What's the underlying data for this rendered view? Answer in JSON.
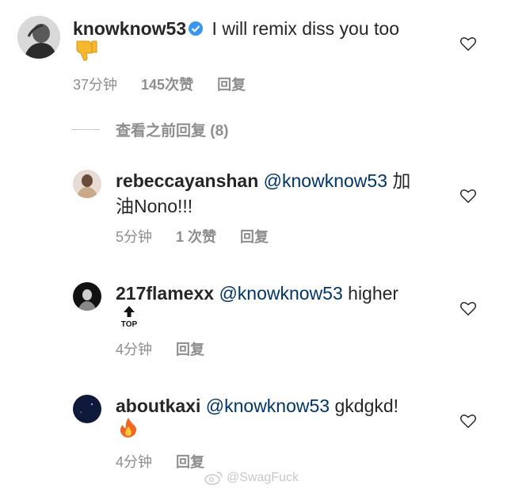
{
  "comments": [
    {
      "username": "knowknow53",
      "verified": true,
      "mention": "",
      "text": "I will remix diss you too",
      "emoji": "thumbs-down",
      "time": "37分钟",
      "likes": "145次赞",
      "reply": "回复"
    },
    {
      "username": "rebeccayanshan",
      "mention": "@knowknow53",
      "text": "加",
      "text2": "油Nono!!!",
      "time": "5分钟",
      "likes": "1 次赞",
      "reply": "回复"
    },
    {
      "username": "217flamexx",
      "mention": "@knowknow53",
      "text": "higher",
      "emoji": "top-arrow",
      "emoji_label": "TOP",
      "time": "4分钟",
      "reply": "回复"
    },
    {
      "username": "aboutkaxi",
      "mention": "@knowknow53",
      "text": "gkdgkd!",
      "emoji": "fire",
      "time": "4分钟",
      "reply": "回复"
    }
  ],
  "view_replies": "查看之前回复 (8)",
  "watermark": "@SwagFuck",
  "colors": {
    "mention": "#003569",
    "meta": "#8e8e8e",
    "verified": "#3897f0"
  }
}
